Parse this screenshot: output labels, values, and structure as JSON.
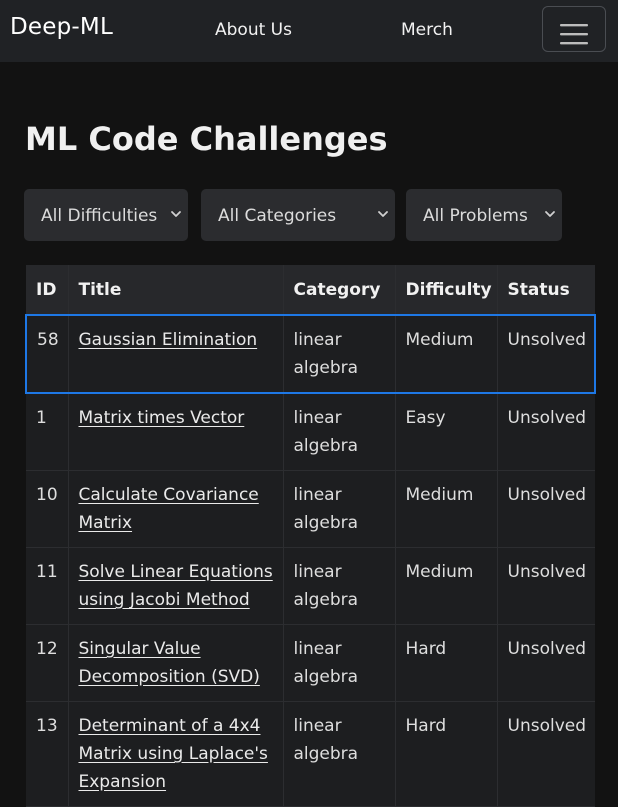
{
  "navbar": {
    "brand": "Deep-ML",
    "links": [
      "About Us",
      "Merch"
    ],
    "toggler_icon": "hamburger-menu-icon"
  },
  "page": {
    "title": "ML Code Challenges"
  },
  "filters": {
    "difficulty": "All Difficulties",
    "category": "All Categories",
    "problems": "All Problems",
    "chevron_icon": "chevron-down-icon"
  },
  "table": {
    "headers": [
      "ID",
      "Title",
      "Category",
      "Difficulty",
      "Status"
    ],
    "rows": [
      {
        "id": "58",
        "title": "Gaussian Elimination",
        "category": "linear algebra",
        "difficulty": "Medium",
        "status": "Unsolved"
      },
      {
        "id": "1",
        "title": "Matrix times Vector",
        "category": "linear algebra",
        "difficulty": "Easy",
        "status": "Unsolved"
      },
      {
        "id": "10",
        "title": "Calculate Covariance Matrix",
        "category": "linear algebra",
        "difficulty": "Medium",
        "status": "Unsolved"
      },
      {
        "id": "11",
        "title": "Solve Linear Equations using Jacobi Method",
        "category": "linear algebra",
        "difficulty": "Medium",
        "status": "Unsolved"
      },
      {
        "id": "12",
        "title": "Singular Value Decomposition (SVD)",
        "category": "linear algebra",
        "difficulty": "Hard",
        "status": "Unsolved"
      },
      {
        "id": "13",
        "title": "Determinant of a 4x4 Matrix using Laplace's Expansion",
        "category": "linear algebra",
        "difficulty": "Hard",
        "status": "Unsolved"
      }
    ]
  },
  "colors": {
    "background": "#121212",
    "navbar": "#202225",
    "easy": "#2ea44f",
    "medium": "#f0b429",
    "hard": "#e5484d",
    "unsolved": "#e5484d",
    "selected_outline": "#1e78e6"
  }
}
